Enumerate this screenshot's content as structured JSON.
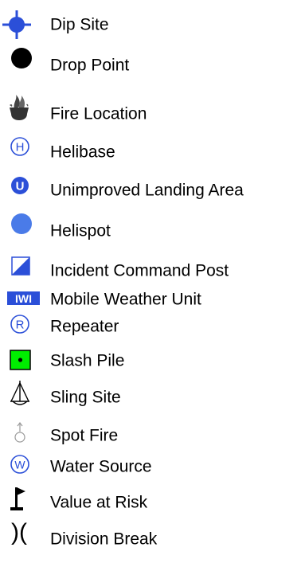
{
  "legend": {
    "items": [
      {
        "icon": "dip-site-icon",
        "label": "Dip Site"
      },
      {
        "icon": "drop-point-icon",
        "label": "Drop Point"
      },
      {
        "icon": "fire-location-icon",
        "label": "Fire Location"
      },
      {
        "icon": "helibase-icon",
        "label": "Helibase",
        "glyph": "H"
      },
      {
        "icon": "unimproved-landing-area-icon",
        "label": "Unimproved Landing Area",
        "glyph": "U"
      },
      {
        "icon": "helispot-icon",
        "label": "Helispot"
      },
      {
        "icon": "incident-command-post-icon",
        "label": "Incident Command Post"
      },
      {
        "icon": "mobile-weather-unit-icon",
        "label": "Mobile Weather Unit",
        "glyph": "IWI"
      },
      {
        "icon": "repeater-icon",
        "label": "Repeater",
        "glyph": "R"
      },
      {
        "icon": "slash-pile-icon",
        "label": "Slash Pile"
      },
      {
        "icon": "sling-site-icon",
        "label": "Sling Site"
      },
      {
        "icon": "spot-fire-icon",
        "label": "Spot Fire"
      },
      {
        "icon": "water-source-icon",
        "label": "Water Source",
        "glyph": "W"
      },
      {
        "icon": "value-at-risk-icon",
        "label": "Value at Risk"
      },
      {
        "icon": "division-break-icon",
        "label": "Division Break",
        "glyph": ")("
      }
    ]
  },
  "colors": {
    "blue": "#2b4fd8",
    "helispot_blue": "#4a7be8",
    "green": "#00ee00",
    "black": "#000000",
    "gray": "#999999"
  }
}
